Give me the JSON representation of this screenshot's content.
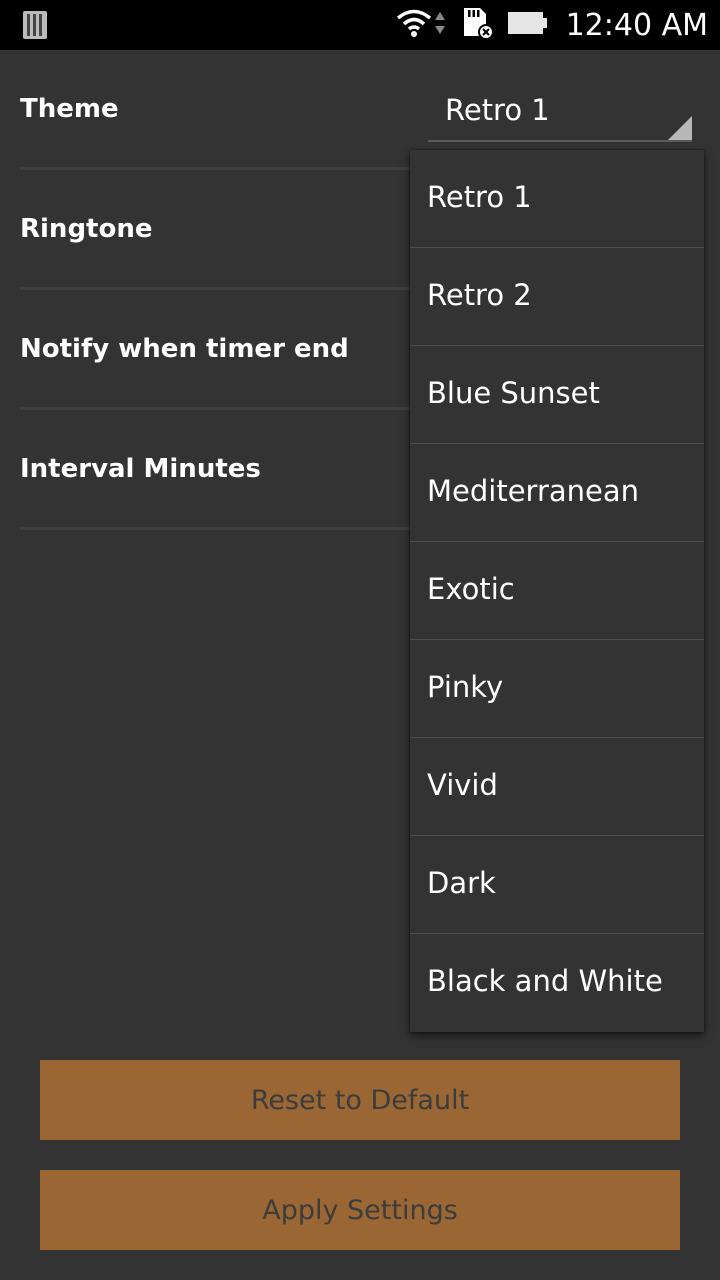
{
  "status_bar": {
    "time": "12:40 AM",
    "icons": [
      "sim-card-icon",
      "wifi-icon",
      "data-arrows-icon",
      "sd-card-error-icon",
      "battery-icon"
    ]
  },
  "settings": {
    "rows": [
      {
        "label": "Theme"
      },
      {
        "label": "Ringtone"
      },
      {
        "label": "Notify when timer end"
      },
      {
        "label": "Interval Minutes"
      }
    ],
    "theme_value": "Retro 1"
  },
  "dropdown": {
    "items": [
      "Retro 1",
      "Retro 2",
      "Blue Sunset",
      "Mediterranean",
      "Exotic",
      "Pinky",
      "Vivid",
      "Dark",
      "Black and White"
    ]
  },
  "buttons": {
    "reset_label": "Reset to Default",
    "apply_label": "Apply Settings"
  },
  "colors": {
    "background": "#333333",
    "button": "#996634",
    "button_text": "#3c3c3c",
    "status_bar": "#000000"
  }
}
